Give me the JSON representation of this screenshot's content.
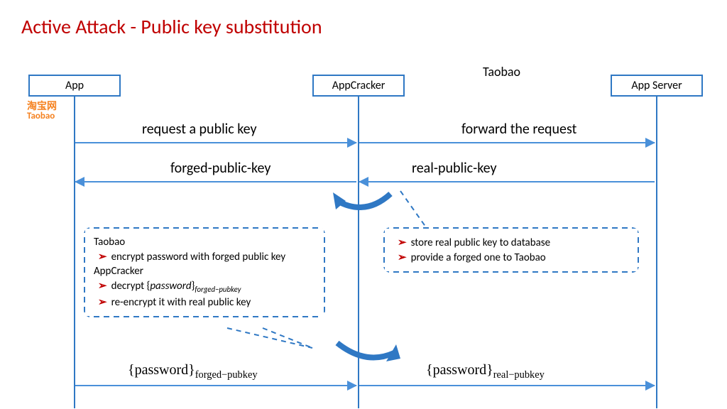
{
  "title": "Active Attack - Public key substitution",
  "taobao_label": "Taobao",
  "taobao_logo_cn": "淘宝网",
  "taobao_logo_en": "Taobao",
  "actors": {
    "app": "App",
    "cracker": "AppCracker",
    "server": "App Server"
  },
  "messages": {
    "m1a": "request a public key",
    "m1b": "forward the request",
    "m2a": "forged-public-key",
    "m2b": "real-public-key",
    "m3a_prefix": "{password}",
    "m3a_sub": "forged−pubkey",
    "m3b_prefix": "{password}",
    "m3b_sub": "real−pubkey"
  },
  "callout_right": {
    "item1": "store real public key to database",
    "item2": "provide a forged one to Taobao"
  },
  "callout_left": {
    "hdr1": "Taobao",
    "item1": "encrypt password with forged public key",
    "hdr2": "AppCracker",
    "item2_prefix": "decrypt {",
    "item2_mid": "password",
    "item2_suffix": "}",
    "item2_sub": "forged−pubkey",
    "item3": "re-encrypt it with real public key"
  }
}
